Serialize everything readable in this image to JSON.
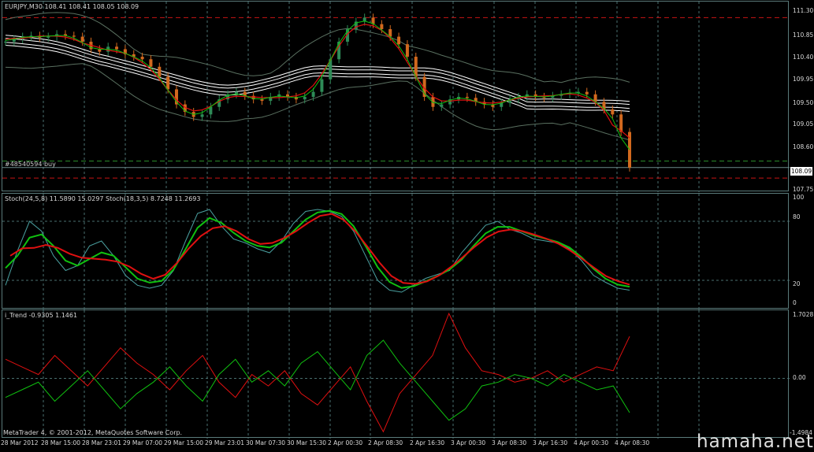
{
  "window": {
    "header": "EURJPY,M30  108.41 108.41 108.05 108.09"
  },
  "order": {
    "label": "#48540594 buy"
  },
  "price_pane": {
    "price_ticks": [
      "111.30",
      "110.85",
      "110.40",
      "109.95",
      "109.50",
      "109.05",
      "108.60",
      "108.09",
      "107.75"
    ],
    "current_price": "108.09"
  },
  "stoch_pane": {
    "label": "Stoch(24,5,8) 11.5890 15.0297  Stoch(18,3,5) 8.7248 11.2693",
    "ticks": [
      "100",
      "80",
      "20",
      "0"
    ]
  },
  "trend_pane": {
    "label": "i_Trend -0.9305 1.1461",
    "ticks": [
      "1.7028",
      "0.00",
      "-1.4984"
    ]
  },
  "time_axis": [
    "28 Mar 2012",
    "28 Mar 15:00",
    "28 Mar 23:01",
    "29 Mar 07:00",
    "29 Mar 15:00",
    "29 Mar 23:01",
    "30 Mar 07:30",
    "30 Mar 15:30",
    "2 Apr 00:30",
    "2 Apr 08:30",
    "2 Apr 16:30",
    "3 Apr 00:30",
    "3 Apr 08:30",
    "3 Apr 16:30",
    "4 Apr 00:30",
    "4 Apr 08:30"
  ],
  "footer": {
    "copyright": "MetaTrader 4, © 2001-2012, MetaQuotes Software Corp.",
    "watermark": "hamaha.net"
  },
  "colors": {
    "background": "#000000",
    "grid": "#4a7070",
    "bull_candle": "#2e8b57",
    "bear_candle": "#d2691e",
    "red_line": "#e01010",
    "green_line": "#10c010",
    "ma_white": "#ffffff",
    "bollinger": "#5a7060",
    "level_dash_red": "#c81414",
    "level_dash_green": "#2a8a2a"
  },
  "chart_data": {
    "type": "line",
    "title": "EURJPY,M30",
    "price_axis_range": [
      107.6,
      111.4
    ],
    "stoch_axis_range": [
      0,
      100
    ],
    "trend_axis_range": [
      -1.4984,
      1.7028
    ],
    "close_series": {
      "name": "EURJPY close",
      "values": [
        110.6,
        110.65,
        110.7,
        110.72,
        110.68,
        110.7,
        110.75,
        110.72,
        110.7,
        110.6,
        110.45,
        110.4,
        110.5,
        110.45,
        110.35,
        110.3,
        110.25,
        110.1,
        109.9,
        109.65,
        109.35,
        109.2,
        109.1,
        109.15,
        109.3,
        109.45,
        109.55,
        109.6,
        109.52,
        109.45,
        109.42,
        109.5,
        109.55,
        109.5,
        109.45,
        109.5,
        109.6,
        109.85,
        110.25,
        110.6,
        110.85,
        111.0,
        111.08,
        110.95,
        110.85,
        110.7,
        110.55,
        110.3,
        109.9,
        109.5,
        109.3,
        109.35,
        109.45,
        109.5,
        109.48,
        109.4,
        109.35,
        109.3,
        109.38,
        109.45,
        109.5,
        109.55,
        109.5,
        109.48,
        109.52,
        109.55,
        109.58,
        109.6,
        109.55,
        109.4,
        109.25,
        109.15,
        108.8,
        108.09
      ]
    },
    "stoch_series": [
      {
        "name": "Stoch(24,5,8)",
        "values": [
          20,
          45,
          70,
          75,
          55,
          35,
          30,
          40,
          55,
          50,
          30,
          20,
          15,
          18,
          25,
          50,
          80,
          90,
          80,
          65,
          60,
          55,
          50,
          55,
          70,
          85,
          90,
          92,
          90,
          80,
          55,
          30,
          15,
          10,
          12,
          20,
          25,
          28,
          40,
          55,
          70,
          78,
          75,
          70,
          65,
          62,
          60,
          55,
          45,
          30,
          20,
          15,
          12
        ]
      },
      {
        "name": "Stoch(18,3,5)",
        "values": [
          15,
          50,
          80,
          70,
          45,
          30,
          35,
          55,
          60,
          45,
          25,
          15,
          12,
          15,
          30,
          60,
          88,
          92,
          75,
          62,
          58,
          52,
          48,
          60,
          78,
          90,
          92,
          90,
          85,
          70,
          45,
          20,
          10,
          8,
          15,
          22,
          26,
          30,
          48,
          62,
          76,
          80,
          72,
          68,
          62,
          60,
          58,
          52,
          40,
          25,
          18,
          12,
          10
        ]
      }
    ],
    "trend_series": [
      {
        "name": "i_Trend red",
        "values": [
          0.5,
          0.3,
          0.1,
          0.6,
          0.2,
          -0.2,
          0.3,
          0.8,
          0.4,
          0.1,
          -0.3,
          0.2,
          0.6,
          -0.1,
          -0.5,
          0.1,
          -0.2,
          0.2,
          -0.4,
          -0.7,
          -0.2,
          0.3,
          -0.6,
          -1.4,
          -0.4,
          0.1,
          0.6,
          1.7,
          0.8,
          0.2,
          0.1,
          -0.1,
          0.0,
          0.2,
          -0.1,
          0.1,
          0.3,
          0.2,
          1.1
        ]
      },
      {
        "name": "i_Trend green",
        "values": [
          -0.5,
          -0.3,
          -0.1,
          -0.6,
          -0.2,
          0.2,
          -0.3,
          -0.8,
          -0.4,
          -0.1,
          0.3,
          -0.2,
          -0.6,
          0.1,
          0.5,
          -0.1,
          0.2,
          -0.2,
          0.4,
          0.7,
          0.2,
          -0.3,
          0.6,
          1.0,
          0.4,
          -0.1,
          -0.6,
          -1.1,
          -0.8,
          -0.2,
          -0.1,
          0.1,
          0.0,
          -0.2,
          0.1,
          -0.1,
          -0.3,
          -0.2,
          -0.9
        ]
      }
    ]
  }
}
